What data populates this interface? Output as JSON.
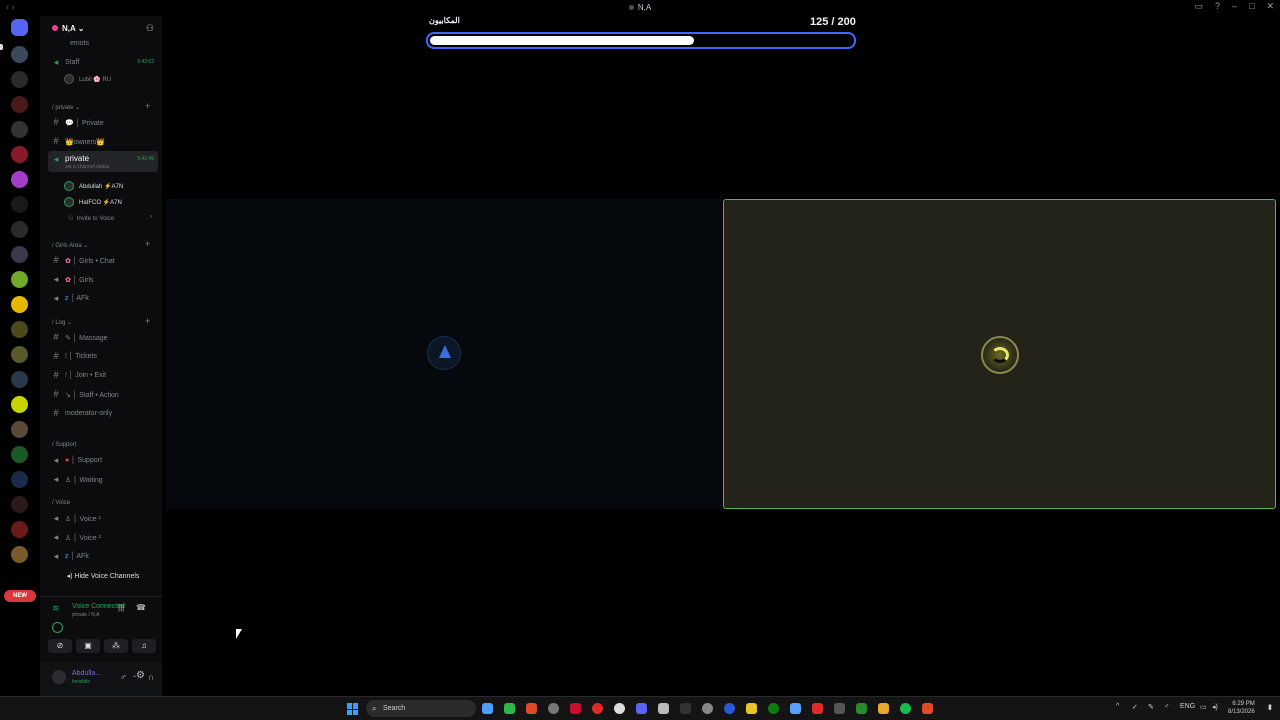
{
  "window": {
    "title": "N,A"
  },
  "server": {
    "name": "N,A"
  },
  "sidebar": {
    "top_item": "emots",
    "staff": {
      "label": "Staff",
      "time": "5:42:02",
      "member": "Lubil 🌸 RU"
    },
    "cat_private": "private",
    "private_text": "Private",
    "owners": "owners",
    "private_voice": {
      "label": "private",
      "time": "5:42:49",
      "sub": "set a channel status"
    },
    "members": [
      {
        "name": "Abdullah ⚡A7N"
      },
      {
        "name": "HaIFCO ⚡A7N"
      }
    ],
    "invite": "Invite to Voice",
    "cat_girls": "Girls Area",
    "girls_chat": "Girls • Chat",
    "girls": "Girls",
    "afk1": "AFk",
    "cat_log": "Log",
    "massage": "Massage",
    "tickets": "Tickets",
    "join_exit": "Join • Exit",
    "staff_action": "Staff • Action",
    "moderator_only": "moderator-only",
    "cat_support": "Support",
    "support": "Support",
    "waiting": "Waiting",
    "cat_voice": "Voice",
    "voice1": "Voice ¹",
    "voice2": "Voice ²",
    "afk2": "AFk",
    "hide_voice": "Hide Voice Channels"
  },
  "server_rail": {
    "new_badge": "NEW"
  },
  "voice_panel": {
    "status": "Voice Connected",
    "location": "private / N,A"
  },
  "user_panel": {
    "name": "Abdulla...",
    "status": "Invisible"
  },
  "activity": {
    "title": "المكابيون",
    "count": "125 / 200",
    "progress_fraction": 0.625
  },
  "taskbar": {
    "search_placeholder": "Search",
    "lang": "ENG",
    "time": "6:29 PM",
    "date": "8/13/2026"
  }
}
